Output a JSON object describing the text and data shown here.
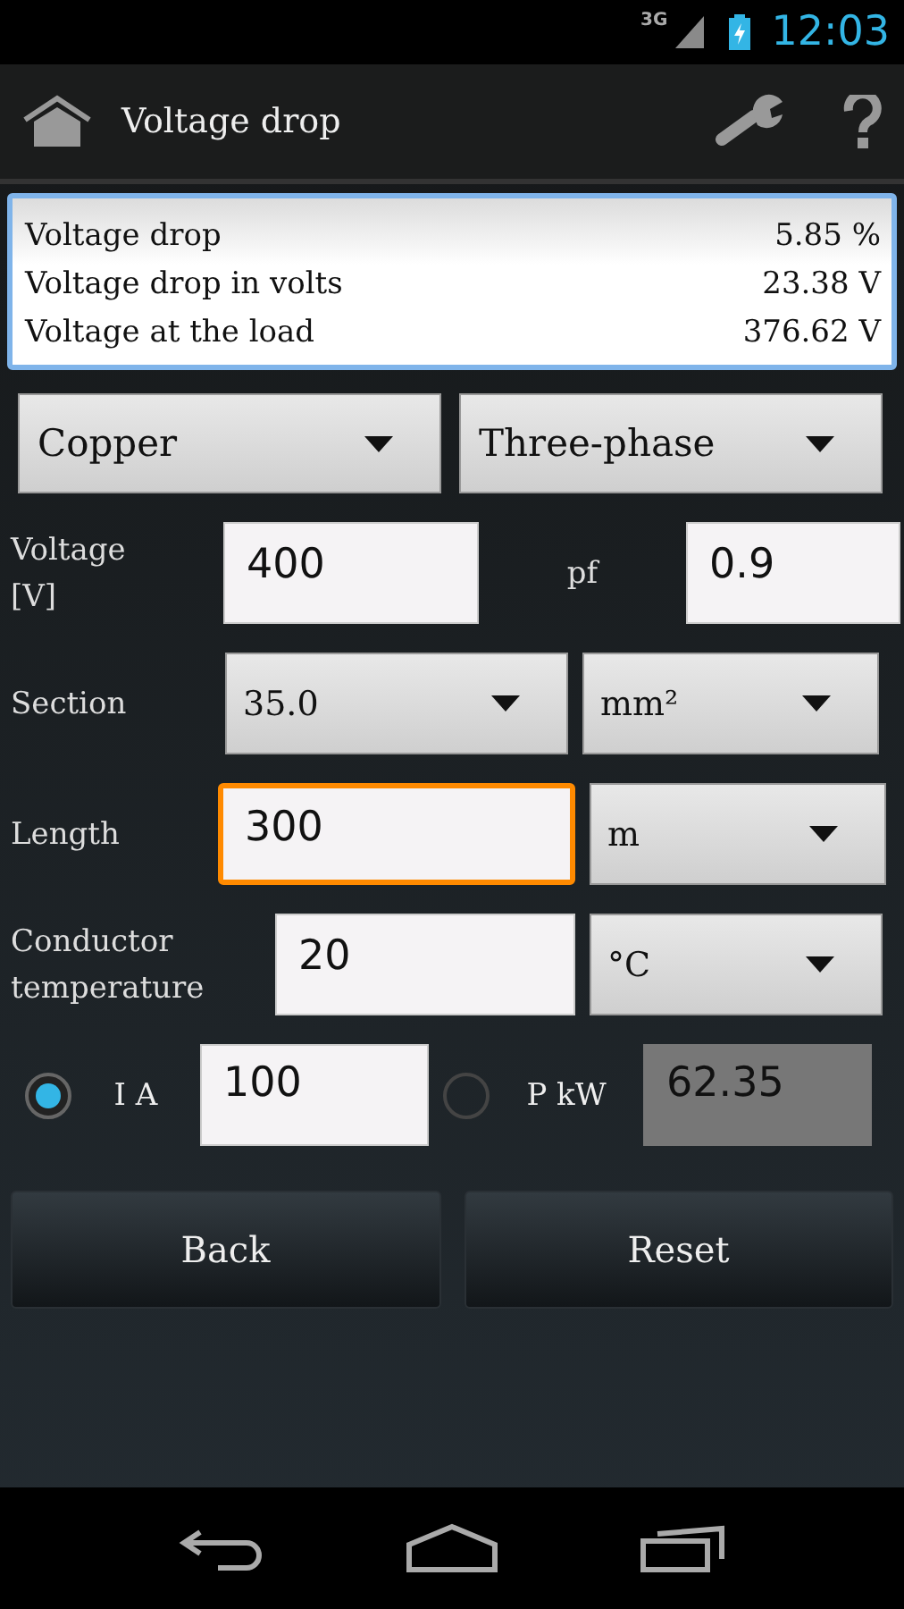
{
  "status_bar": {
    "network": "3G",
    "time": "12:03"
  },
  "action_bar": {
    "title": "Voltage drop"
  },
  "results": [
    {
      "label": "Voltage drop",
      "value": "5.85 %"
    },
    {
      "label": "Voltage drop in volts",
      "value": "23.38 V"
    },
    {
      "label": "Voltage at the load",
      "value": "376.62 V"
    }
  ],
  "selectors": [
    {
      "value": "Copper"
    },
    {
      "value": "Three-phase"
    }
  ],
  "rows": [
    {
      "label": "Voltage\n[V]",
      "controls": [
        {
          "kind": "input",
          "value": "400",
          "focused": false
        },
        {
          "kind": "label",
          "text": "pf"
        },
        {
          "kind": "input",
          "value": "0.9",
          "focused": false
        }
      ]
    },
    {
      "label": "Section",
      "controls": [
        {
          "kind": "select",
          "value": "35.0"
        },
        {
          "kind": "select",
          "value": "mm²"
        }
      ]
    },
    {
      "label": "Length",
      "controls": [
        {
          "kind": "input",
          "value": "300",
          "focused": true
        },
        {
          "kind": "select",
          "value": "m"
        }
      ]
    },
    {
      "label": "Conductor\ntemperature",
      "controls": [
        {
          "kind": "input",
          "value": "20",
          "focused": false
        },
        {
          "kind": "select",
          "value": "°C"
        }
      ]
    }
  ],
  "mode": [
    {
      "label": "I A",
      "value": "100",
      "selected": true,
      "disabled": false
    },
    {
      "label": "P kW",
      "value": "62.35",
      "selected": false,
      "disabled": true
    }
  ],
  "buttons": [
    "Back",
    "Reset"
  ]
}
